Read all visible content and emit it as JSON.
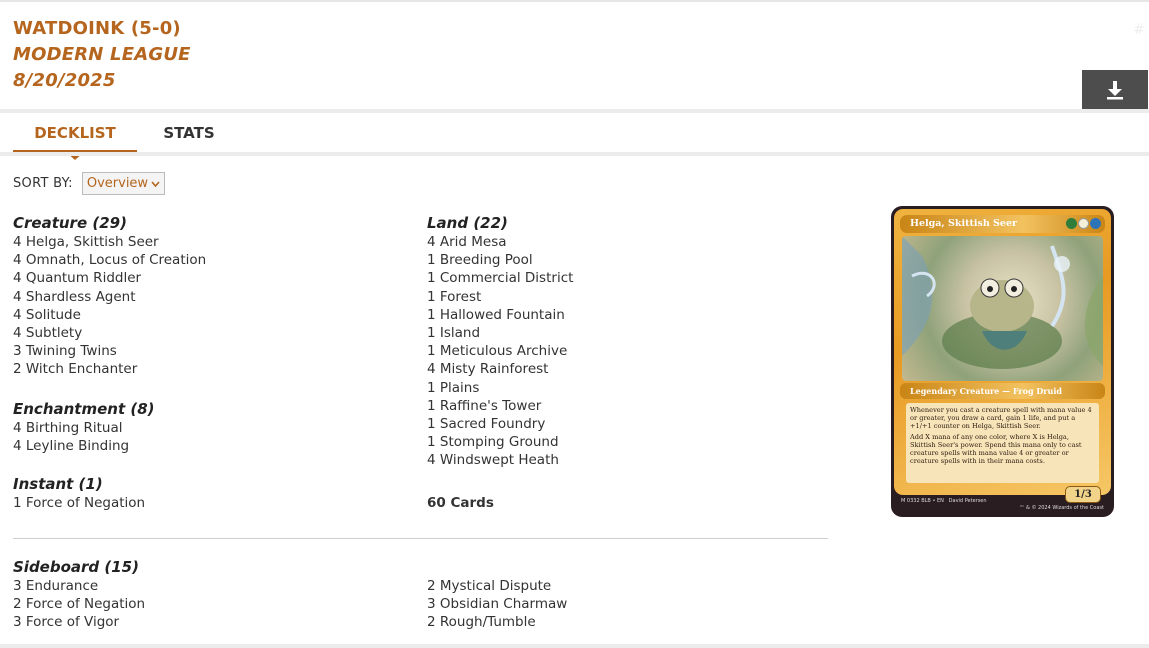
{
  "header": {
    "title": "WATDOINK (5-0)",
    "event": "MODERN LEAGUE",
    "date": "8/20/2025",
    "hash": "#"
  },
  "toolbar": {
    "download_icon": "download-icon"
  },
  "tabs": [
    {
      "label": "DECKLIST",
      "active": true
    },
    {
      "label": "STATS",
      "active": false
    }
  ],
  "sort": {
    "label": "SORT BY:",
    "selected": "Overview"
  },
  "main": {
    "left": [
      {
        "title": "Creature (29)",
        "cards": [
          "4 Helga, Skittish Seer",
          "4 Omnath, Locus of Creation",
          "4 Quantum Riddler",
          "4 Shardless Agent",
          "4 Solitude",
          "4 Subtlety",
          "3 Twining Twins",
          "2 Witch Enchanter"
        ]
      },
      {
        "title": "Enchantment (8)",
        "cards": [
          "4 Birthing Ritual",
          "4 Leyline Binding"
        ]
      },
      {
        "title": "Instant (1)",
        "cards": [
          "1 Force of Negation"
        ]
      }
    ],
    "right": [
      {
        "title": "Land (22)",
        "cards": [
          "4 Arid Mesa",
          "1 Breeding Pool",
          "1 Commercial District",
          "1 Forest",
          "1 Hallowed Fountain",
          "1 Island",
          "1 Meticulous Archive",
          "4 Misty Rainforest",
          "1 Plains",
          "1 Raffine's Tower",
          "1 Sacred Foundry",
          "1 Stomping Ground",
          "4 Windswept Heath"
        ]
      }
    ],
    "total": "60 Cards"
  },
  "sideboard": {
    "title": "Sideboard (15)",
    "left": [
      "3 Endurance",
      "2 Force of Negation",
      "3 Force of Vigor"
    ],
    "right": [
      "2 Mystical Dispute",
      "3 Obsidian Charmaw",
      "2 Rough/Tumble"
    ]
  },
  "card_preview": {
    "name": "Helga, Skittish Seer",
    "type": "Legendary Creature — Frog Druid",
    "text1": "Whenever you cast a creature spell with mana value 4 or greater, you draw a card, gain 1 life, and put a +1/+1 counter on Helga, Skittish Seer.",
    "text2": "Add X mana of any one color, where X is Helga, Skittish Seer's power. Spend this mana only to cast creature spells with mana value 4 or greater or creature spells with in their mana costs.",
    "pt": "1/3",
    "footer_left": "M 0332 BLB • EN",
    "artist": "David Petersen",
    "copyright": "™ & © 2024 Wizards of the Coast",
    "colors": {
      "green": "#2f7d3a",
      "white": "#f4efd6",
      "blue": "#2d73b8",
      "accent": "#b5651d"
    }
  }
}
